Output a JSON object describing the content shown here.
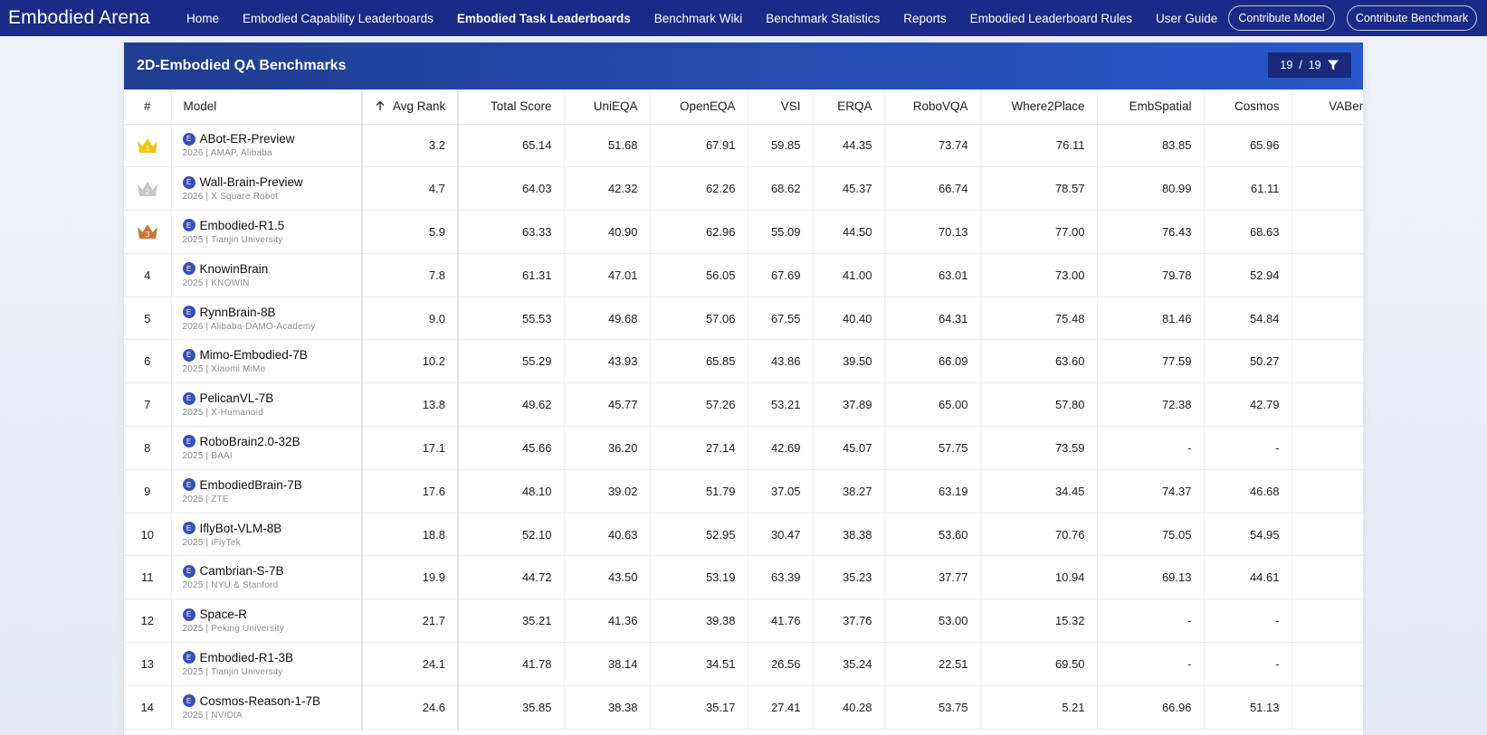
{
  "nav": {
    "brand": "Embodied Arena",
    "links": [
      {
        "label": "Home",
        "active": false
      },
      {
        "label": "Embodied Capability Leaderboards",
        "active": false
      },
      {
        "label": "Embodied Task Leaderboards",
        "active": true
      },
      {
        "label": "Benchmark Wiki",
        "active": false
      },
      {
        "label": "Benchmark Statistics",
        "active": false
      },
      {
        "label": "Reports",
        "active": false
      },
      {
        "label": "Embodied Leaderboard Rules",
        "active": false
      },
      {
        "label": "User Guide",
        "active": false
      }
    ],
    "contribute_model": "Contribute Model",
    "contribute_benchmark": "Contribute Benchmark"
  },
  "panel": {
    "title": "2D-Embodied QA Benchmarks",
    "filter_count": "19  /  19",
    "filter_icon": "filter-icon"
  },
  "table": {
    "columns": [
      "#",
      "Model",
      "Avg Rank",
      "Total Score",
      "UniEQA",
      "OpenEQA",
      "VSI",
      "ERQA",
      "RoboVQA",
      "Where2Place",
      "EmbSpatial",
      "Cosmos",
      "VABench"
    ],
    "sort_icon": "arrow-up-icon",
    "rows": [
      {
        "rank": "1",
        "crown": "gold",
        "name": "ABot-ER-Preview",
        "meta": "2026 | AMAP, Alibaba",
        "values": [
          "3.2",
          "65.14",
          "51.68",
          "67.91",
          "59.85",
          "44.35",
          "73.74",
          "76.11",
          "83.85",
          "65.96",
          ""
        ]
      },
      {
        "rank": "2",
        "crown": "silver",
        "name": "Wall-Brain-Preview",
        "meta": "2026 | X Square Robot",
        "values": [
          "4.7",
          "64.03",
          "42.32",
          "62.26",
          "68.62",
          "45.37",
          "66.74",
          "78.57",
          "80.99",
          "61.11",
          ""
        ]
      },
      {
        "rank": "3",
        "crown": "bronze",
        "name": "Embodied-R1.5",
        "meta": "2025 | Tianjin University",
        "values": [
          "5.9",
          "63.33",
          "40.90",
          "62.96",
          "55.09",
          "44.50",
          "70.13",
          "77.00",
          "76.43",
          "68.63",
          ""
        ]
      },
      {
        "rank": "4",
        "crown": "",
        "name": "KnowinBrain",
        "meta": "2025 | KNOWIN",
        "values": [
          "7.8",
          "61.31",
          "47.01",
          "56.05",
          "67.69",
          "41.00",
          "63.01",
          "73.00",
          "79.78",
          "52.94",
          ""
        ]
      },
      {
        "rank": "5",
        "crown": "",
        "name": "RynnBrain-8B",
        "meta": "2026 | Alibaba-DAMO-Academy",
        "values": [
          "9.0",
          "55.53",
          "49.68",
          "57.06",
          "67.55",
          "40.40",
          "64.31",
          "75.48",
          "81.46",
          "54.84",
          ""
        ]
      },
      {
        "rank": "6",
        "crown": "",
        "name": "Mimo-Embodied-7B",
        "meta": "2025 | Xiaomi MiMo",
        "values": [
          "10.2",
          "55.29",
          "43.93",
          "65.85",
          "43.86",
          "39.50",
          "66.09",
          "63.60",
          "77.59",
          "50.27",
          ""
        ]
      },
      {
        "rank": "7",
        "crown": "",
        "name": "PelicanVL-7B",
        "meta": "2025 | X-Humanoid",
        "values": [
          "13.8",
          "49.62",
          "45.77",
          "57.26",
          "53.21",
          "37.89",
          "65.00",
          "57.80",
          "72.38",
          "42.79",
          ""
        ]
      },
      {
        "rank": "8",
        "crown": "",
        "name": "RoboBrain2.0-32B",
        "meta": "2025 | BAAI",
        "values": [
          "17.1",
          "45.66",
          "36.20",
          "27.14",
          "42.69",
          "45.07",
          "57.75",
          "73.59",
          "-",
          "-",
          ""
        ]
      },
      {
        "rank": "9",
        "crown": "",
        "name": "EmbodiedBrain-7B",
        "meta": "2025 | ZTE",
        "values": [
          "17.6",
          "48.10",
          "39.02",
          "51.79",
          "37.05",
          "38.27",
          "63.19",
          "34.45",
          "74.37",
          "46.68",
          ""
        ]
      },
      {
        "rank": "10",
        "crown": "",
        "name": "IflyBot-VLM-8B",
        "meta": "2025 | iFlyTek",
        "values": [
          "18.8",
          "52.10",
          "40.63",
          "52.95",
          "30.47",
          "38.38",
          "53.60",
          "70.76",
          "75.05",
          "54.95",
          ""
        ]
      },
      {
        "rank": "11",
        "crown": "",
        "name": "Cambrian-S-7B",
        "meta": "2025 | NYU & Stanford",
        "values": [
          "19.9",
          "44.72",
          "43.50",
          "53.19",
          "63.39",
          "35.23",
          "37.77",
          "10.94",
          "69.13",
          "44.61",
          ""
        ]
      },
      {
        "rank": "12",
        "crown": "",
        "name": "Space-R",
        "meta": "2025 | Peking University",
        "values": [
          "21.7",
          "35.21",
          "41.36",
          "39.38",
          "41.76",
          "37.76",
          "53.00",
          "15.32",
          "-",
          "-",
          ""
        ]
      },
      {
        "rank": "13",
        "crown": "",
        "name": "Embodied-R1-3B",
        "meta": "2025 | Tianjin University",
        "values": [
          "24.1",
          "41.78",
          "38.14",
          "34.51",
          "26.56",
          "35.24",
          "22.51",
          "69.50",
          "-",
          "-",
          ""
        ]
      },
      {
        "rank": "14",
        "crown": "",
        "name": "Cosmos-Reason-1-7B",
        "meta": "2025 | NVIDIA",
        "values": [
          "24.6",
          "35.85",
          "38.38",
          "35.17",
          "27.41",
          "40.28",
          "53.75",
          "5.21",
          "66.96",
          "51.13",
          ""
        ]
      }
    ]
  },
  "colors": {
    "nav_bg": "#1b2a86",
    "header_start": "#1f3d8f",
    "header_end": "#2858c9",
    "gold": "#f2c418",
    "silver": "#c8c8c8",
    "bronze": "#c8793a",
    "badge": "#3b4fb8"
  }
}
